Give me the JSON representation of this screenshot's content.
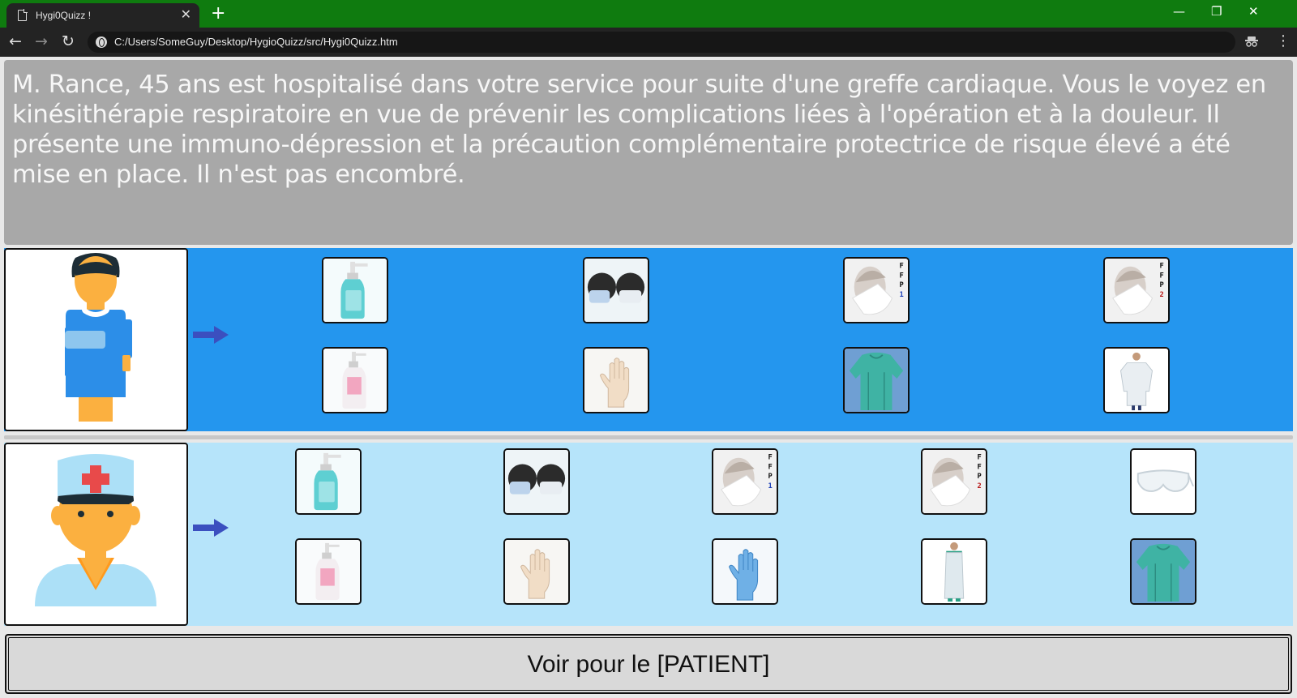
{
  "browser": {
    "tab_title": "Hygi0Quizz !",
    "tab_close": "✕",
    "new_tab": "+",
    "url": "C:/Users/SomeGuy/Desktop/HygioQuizz/src/Hygi0Quizz.htm",
    "window_controls": {
      "minimize": "—",
      "restore": "❐",
      "close": "✕"
    },
    "nav": {
      "back": "←",
      "forward": "→",
      "reload": "↻"
    },
    "menu": "⋮"
  },
  "question": {
    "text": "M. Rance, 45 ans est hospitalisé dans votre service pour suite d'une greffe cardiaque. Vous le voyez en kinésithérapie respiratoire en vue de prévenir les complications liées à l'opération et à la douleur. Il présente une immuno-dépression et la précaution complémentaire protectrice de risque élevé a été mise en place. Il n'est pas encombré."
  },
  "patient_panel": {
    "avatar_icon": "patient-icon",
    "items": [
      {
        "name": "hand-sanitizer-icon"
      },
      {
        "name": "surgical-mask-icon"
      },
      {
        "name": "ffp1-mask-icon",
        "label": [
          "F",
          "F",
          "P",
          "1"
        ],
        "label_color": "#1b3fb8"
      },
      {
        "name": "ffp2-mask-icon",
        "label": [
          "F",
          "F",
          "P",
          "2"
        ],
        "label_color": "#b81b1b"
      },
      {
        "name": "soap-bottle-icon"
      },
      {
        "name": "glove-icon"
      },
      {
        "name": "protective-gown-icon"
      },
      {
        "name": "lab-coat-icon"
      }
    ]
  },
  "professional_panel": {
    "avatar_icon": "nurse-icon",
    "items": [
      {
        "name": "hand-sanitizer-icon"
      },
      {
        "name": "surgical-mask-icon"
      },
      {
        "name": "ffp1-mask-icon",
        "label": [
          "F",
          "F",
          "P",
          "1"
        ],
        "label_color": "#1b3fb8"
      },
      {
        "name": "ffp2-mask-icon",
        "label": [
          "F",
          "F",
          "P",
          "2"
        ],
        "label_color": "#b81b1b"
      },
      {
        "name": "safety-glasses-icon"
      },
      {
        "name": "soap-bottle-icon"
      },
      {
        "name": "latex-glove-icon"
      },
      {
        "name": "nitrile-glove-icon"
      },
      {
        "name": "plastic-apron-icon"
      },
      {
        "name": "protective-gown-icon"
      }
    ]
  },
  "colors": {
    "tab_strip": "#0f7b0f",
    "question_bg": "#a8a8a8",
    "patient_panel_bg": "#2496ee",
    "professional_panel_bg": "#b6e4fa",
    "arrow": "#3b4fbf"
  },
  "action": {
    "label": "Voir pour le [PATIENT]"
  }
}
